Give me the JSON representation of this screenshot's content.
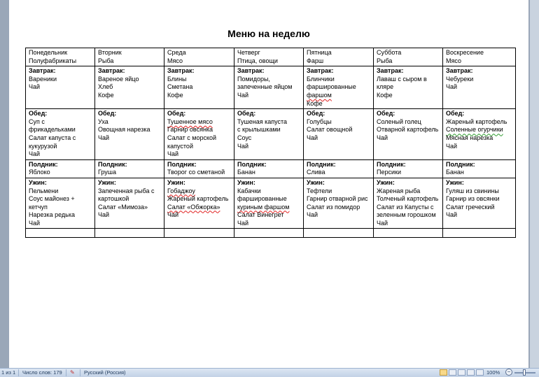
{
  "title": "Меню на неделю",
  "days": [
    {
      "day": "Понедельник",
      "theme": "Полуфабрикаты"
    },
    {
      "day": "Вторник",
      "theme": "Рыба"
    },
    {
      "day": "Среда",
      "theme": "Мясо"
    },
    {
      "day": "Четверг",
      "theme": "Птица, овощи"
    },
    {
      "day": "Пятница",
      "theme": "Фарш"
    },
    {
      "day": "Суббота",
      "theme": "Рыба"
    },
    {
      "day": "Воскресение",
      "theme": "Мясо"
    }
  ],
  "meal_labels": {
    "breakfast": "Завтрак:",
    "lunch": "Обед:",
    "snack": "Полдник:",
    "dinner": "Ужин:"
  },
  "breakfast": [
    [
      " Вареники",
      "Чай"
    ],
    [
      "Вареное яйцо",
      "Хлеб",
      "Кофе"
    ],
    [
      "Блины",
      "Сметана",
      "Кофе"
    ],
    [
      "Помидоры,",
      "запеченные яйцом",
      "Чай"
    ],
    [
      "Блинчики",
      "фаршированные",
      "фаршом",
      "Кофе"
    ],
    [
      "Лаваш с сыром в",
      "кляре",
      "Кофе"
    ],
    [
      "Чебуреки",
      "Чай"
    ]
  ],
  "lunch": [
    [
      "Суп с",
      "фрикадельками",
      "Салат капуста с",
      "кукурузой",
      "Чай"
    ],
    [
      "Уха",
      "Овощная нарезка",
      "Чай"
    ],
    [
      "Тушенное мясо",
      "Гарнир овсянка",
      "Салат с морской",
      "капустой",
      "Чай"
    ],
    [
      "Тушеная капуста",
      "с крылышками",
      "Соус",
      "Чай"
    ],
    [
      "Голубцы",
      "Салат овощной",
      "Чай"
    ],
    [
      "Соленый голец",
      "Отварной картофель",
      "Чай"
    ],
    [
      "Жареный картофель",
      "Соленные огурчики",
      "Мясная нарезка",
      "Чай"
    ]
  ],
  "snack": [
    [
      "Яблоко"
    ],
    [
      "Груша"
    ],
    [
      "Творог со сметаной"
    ],
    [
      "Банан"
    ],
    [
      "Слива"
    ],
    [
      "Персики"
    ],
    [
      "Банан"
    ]
  ],
  "dinner": [
    [
      "Пельмени",
      "Соус майонез +",
      "кетчуп",
      "Нарезка редька",
      "Чай"
    ],
    [
      "Запеченная рыба с",
      "картошкой",
      "Салат «Мимоза»",
      "Чай"
    ],
    [
      "Гобаджоу",
      "Жареный картофель",
      "Салат «Обжорка»",
      "Чай"
    ],
    [
      "Кабачки",
      "фаршированные",
      "куриным фаршом",
      "Салат Винегрет",
      "Чай"
    ],
    [
      "Тефтели",
      "Гарнир отварной рис",
      "Салат из помидор",
      "Чай"
    ],
    [
      "Жареная рыба",
      "Толченый картофель",
      "Салат из Капусты с",
      "зеленным горошком",
      "Чай"
    ],
    [
      "Гуляш из свинины",
      "Гарнир из овсянки",
      "Салат греческий",
      "Чай"
    ]
  ],
  "status": {
    "page": "1 из 1",
    "words": "Число слов: 179",
    "language": "Русский (Россия)",
    "zoom": "100%"
  }
}
